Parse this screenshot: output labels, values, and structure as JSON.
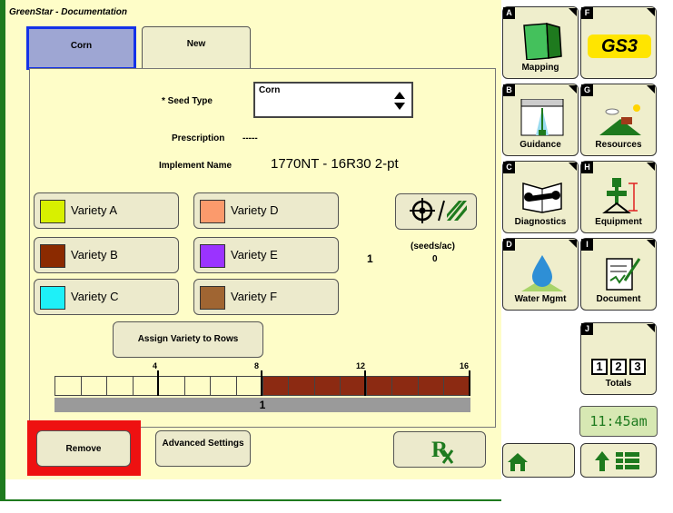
{
  "app": {
    "title": "GreenStar - Documentation"
  },
  "tabs": [
    {
      "label": "Corn",
      "active": true
    },
    {
      "label": "New",
      "active": false
    }
  ],
  "form": {
    "seed_type_label": "* Seed Type",
    "seed_type_value": "Corn",
    "prescription_label": "Prescription",
    "prescription_value": "-----",
    "implement_label": "Implement Name",
    "implement_value": "1770NT - 16R30 2-pt"
  },
  "varieties": [
    {
      "label": "Variety A",
      "color": "#d8f000"
    },
    {
      "label": "Variety B",
      "color": "#8b2a00"
    },
    {
      "label": "Variety C",
      "color": "#1ef0f8"
    },
    {
      "label": "Variety D",
      "color": "#fb9a6c"
    },
    {
      "label": "Variety E",
      "color": "#9b33ff"
    },
    {
      "label": "Variety F",
      "color": "#a06532"
    }
  ],
  "rate": {
    "units": "(seeds/ac)",
    "count": "1",
    "value": "0"
  },
  "assign_button": "Assign Variety to Rows",
  "rows": {
    "total": 16,
    "assigned_start": 9,
    "ticks": [
      "4",
      "8",
      "12",
      "16"
    ],
    "bar_label": "1"
  },
  "buttons": {
    "remove": "Remove",
    "advanced": "Advanced Settings"
  },
  "sidebar": [
    {
      "key": "A",
      "label": "Mapping",
      "icon": "mapping-icon"
    },
    {
      "key": "F",
      "label": "GS3",
      "icon": "gs3-logo"
    },
    {
      "key": "B",
      "label": "Guidance",
      "icon": "guidance-icon"
    },
    {
      "key": "G",
      "label": "Resources",
      "icon": "resources-icon"
    },
    {
      "key": "C",
      "label": "Diagnostics",
      "icon": "wrench-icon"
    },
    {
      "key": "H",
      "label": "Equipment",
      "icon": "equipment-icon"
    },
    {
      "key": "D",
      "label": "Water Mgmt",
      "icon": "water-drop-icon"
    },
    {
      "key": "I",
      "label": "Document",
      "icon": "document-icon"
    },
    {
      "key": "J",
      "label": "Totals",
      "icon": "totals-icon"
    }
  ],
  "totals_digits": [
    "1",
    "2",
    "3"
  ],
  "clock": "11:45am",
  "colors": {
    "frame": "#1e7a1e",
    "screen": "#fefdc8",
    "row_assigned": "#8c2a12",
    "highlight": "#ee1111"
  }
}
